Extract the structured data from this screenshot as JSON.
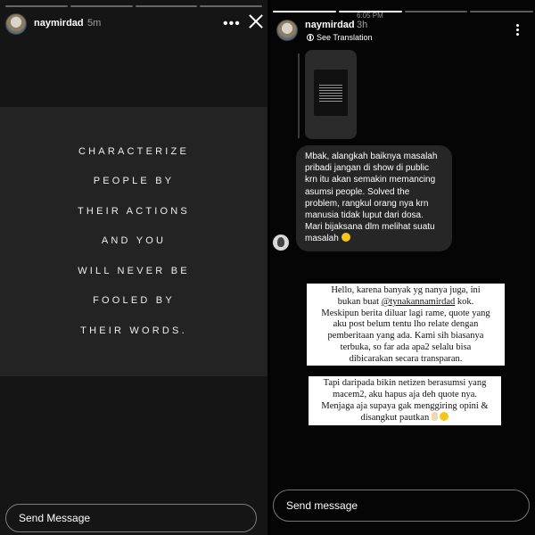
{
  "left_story": {
    "username": "naymirdad",
    "time": "5m",
    "progress": {
      "total": 4,
      "active_index": 0
    },
    "quote_lines": [
      "CHARACTERIZE",
      "PEOPLE BY",
      "THEIR ACTIONS",
      "AND YOU",
      "WILL NEVER BE",
      "FOOLED BY",
      "THEIR WORDS."
    ],
    "send_placeholder": "Send Message",
    "icons": {
      "more": "more-horizontal-icon",
      "close": "close-icon"
    }
  },
  "right_story": {
    "status_time": "6:05 PM",
    "username": "naymirdad",
    "time": "3h",
    "translation_label": "See Translation",
    "progress": {
      "total": 4,
      "active_index": 2
    },
    "comment_lines": [
      "Mbak, alangkah baiknya masalah",
      "pribadi jangan di show di public",
      "krn itu akan semakin memancing",
      "asumsi people. Solved the",
      "problem, rangkul orang nya krn",
      "manusia tidak luput dari dosa.",
      "Mari bijaksana dlm melihat suatu",
      "masalah"
    ],
    "note1": {
      "line1": "Hello, karena banyak yg nanya juga, ini",
      "line2_prefix": "bukan buat ",
      "mention": "@tynakannamirdad",
      "line2_suffix": " kok.",
      "rest": [
        "Meskipun berita diluar lagi rame, quote yang",
        "aku post belum tentu lho relate dengan",
        "pemberitaan yang ada. Kami sih biasanya",
        "terbuka, so far ada apa2 selalu bisa",
        "dibicarakan secara transparan."
      ]
    },
    "note2": [
      "Tapi daripada bikin netizen berasumsi yang",
      "macem2, aku hapus aja deh quote nya.",
      "Menjaga aja supaya gak menggiring opini &",
      "disangkut pautkan"
    ],
    "send_placeholder": "Send message",
    "icons": {
      "more": "more-vertical-icon",
      "translate": "globe-icon"
    }
  }
}
